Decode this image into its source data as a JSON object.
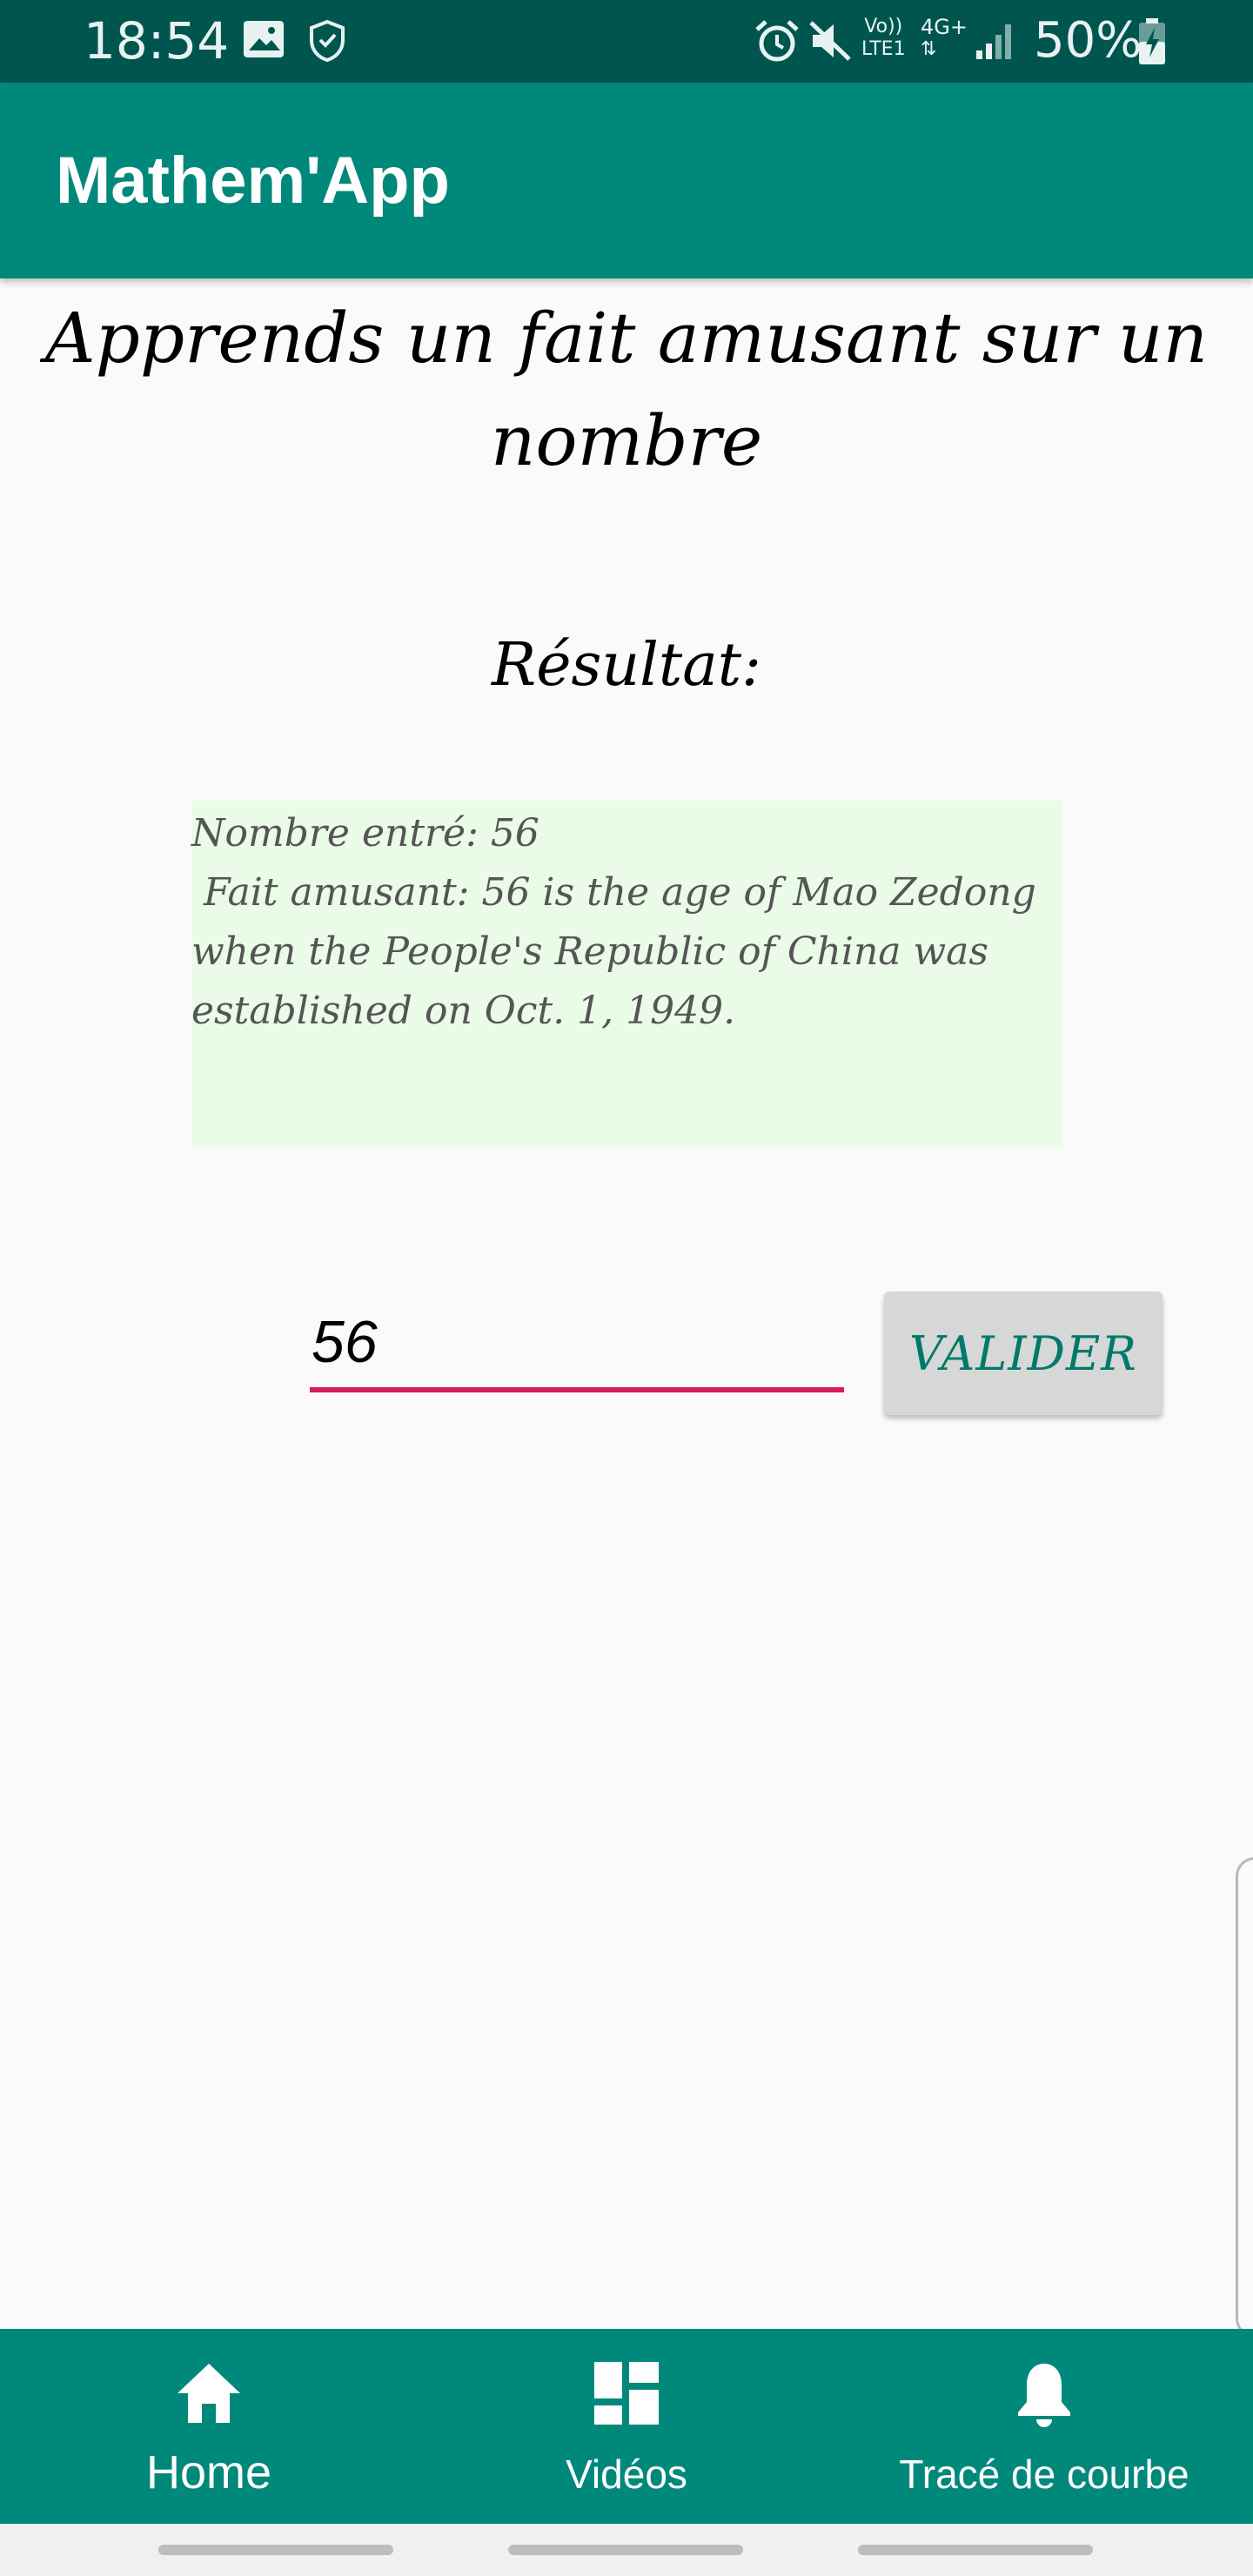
{
  "status_bar": {
    "time": "18:54",
    "battery": "50%",
    "icons": [
      "image-icon",
      "shield-icon",
      "alarm-icon",
      "mute-icon",
      "volte-icon",
      "4g-icon",
      "signal-icon",
      "battery-charging-icon"
    ],
    "network_label_top": "Vo))",
    "network_label_bottom": "LTE1",
    "network_type": "4G+"
  },
  "app_bar": {
    "title": "Mathem'App"
  },
  "main": {
    "heading": "Apprends un fait amusant sur un nombre",
    "result_label": "Résultat:",
    "result_text": "Nombre entré: 56\n Fait amusant: 56 is the age of Mao Zedong when the People's Republic of China was established on Oct. 1, 1949.",
    "input_value": "56",
    "validate_label": "VALIDER"
  },
  "bottom_nav": {
    "items": [
      {
        "label": "Home",
        "icon": "home-icon"
      },
      {
        "label": "Vidéos",
        "icon": "dashboard-icon"
      },
      {
        "label": "Tracé de courbe",
        "icon": "bell-icon"
      }
    ]
  },
  "colors": {
    "status_bar": "#00564f",
    "primary": "#00897b",
    "accent": "#d81b60",
    "result_background": "#eafbe8"
  }
}
